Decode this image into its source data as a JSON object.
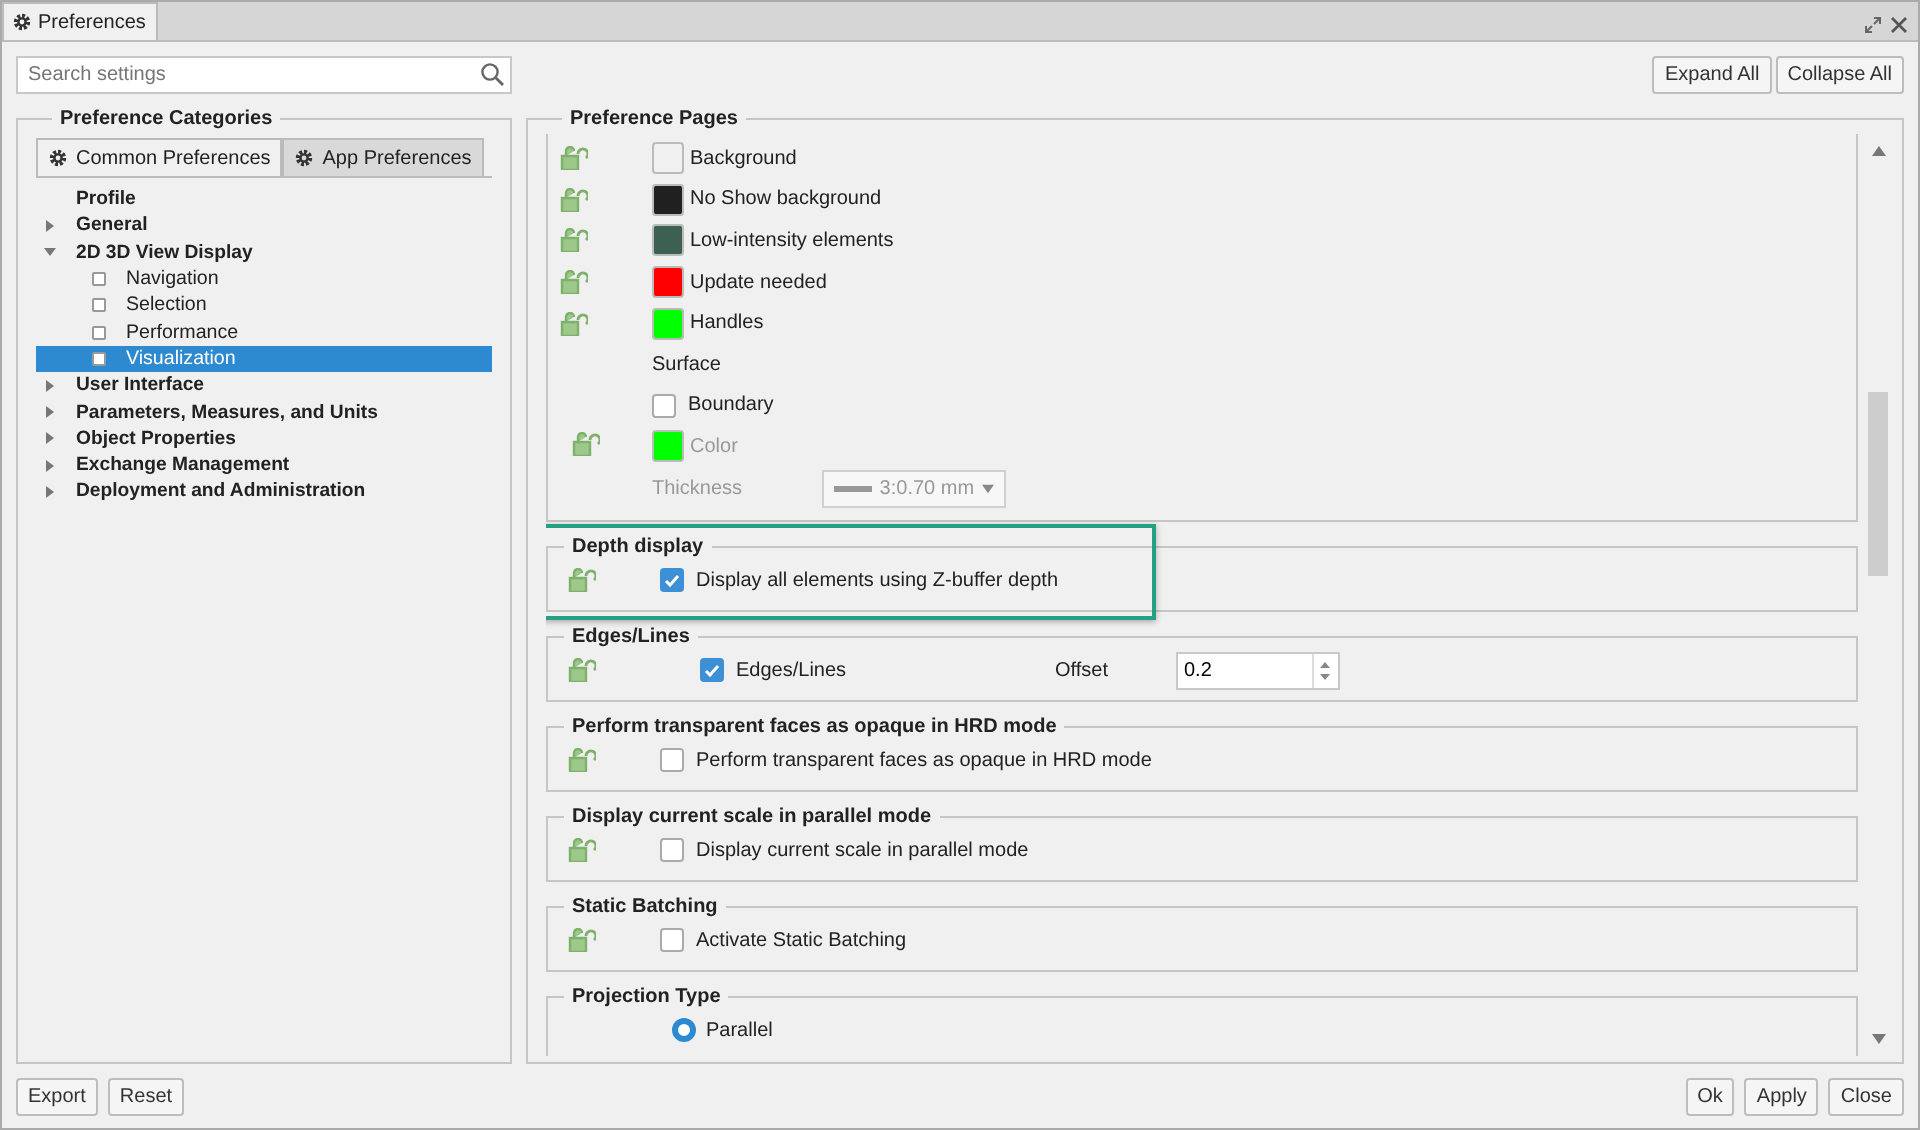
{
  "window": {
    "tab": "Preferences"
  },
  "search": {
    "placeholder": "Search settings"
  },
  "top_buttons": [
    "Expand All",
    "Collapse All"
  ],
  "categories": {
    "title": "Preference Categories",
    "tabs": [
      {
        "label": "Common Preferences",
        "selected": true
      },
      {
        "label": "App Preferences",
        "selected": false
      }
    ],
    "tree": [
      {
        "label": "Profile",
        "selected": false
      },
      {
        "label": "General",
        "expanded": false,
        "selected": false
      },
      {
        "label": "2D 3D View Display",
        "expanded": true,
        "selected": false,
        "children": [
          {
            "label": "Navigation",
            "selected": false
          },
          {
            "label": "Selection",
            "selected": false
          },
          {
            "label": "Performance",
            "selected": false
          },
          {
            "label": "Visualization",
            "selected": true
          }
        ]
      },
      {
        "label": "User Interface",
        "expanded": false,
        "selected": false
      },
      {
        "label": "Parameters, Measures, and Units",
        "expanded": false,
        "selected": false
      },
      {
        "label": "Object Properties",
        "expanded": false,
        "selected": false
      },
      {
        "label": "Exchange Management",
        "expanded": false,
        "selected": false
      },
      {
        "label": "Deployment and Administration",
        "expanded": false,
        "selected": false
      }
    ]
  },
  "pages": {
    "title": "Preference Pages",
    "color_rows": [
      {
        "label": "Background",
        "color": "#f0f0f0"
      },
      {
        "label": "No Show background",
        "color": "#202020"
      },
      {
        "label": "Low-intensity elements",
        "color": "#3d6150"
      },
      {
        "label": "Update needed",
        "color": "#ff0000"
      },
      {
        "label": "Handles",
        "color": "#00ff00"
      }
    ],
    "surface": {
      "heading": "Surface",
      "boundary": {
        "label": "Boundary",
        "checked": false
      },
      "color": {
        "label": "Color",
        "color": "#00ff00",
        "disabled": true
      },
      "thickness": {
        "label": "Thickness",
        "value": "3:0.70 mm",
        "disabled": true
      }
    },
    "groups": [
      {
        "title": "Depth display",
        "kind": "checkbox",
        "label": "Display all elements using Z-buffer depth",
        "checked": true,
        "highlighted": true
      },
      {
        "title": "Edges/Lines",
        "kind": "offset",
        "label": "Edges/Lines",
        "checked": true,
        "offset_label": "Offset",
        "offset_value": "0.2",
        "highlighted": false
      },
      {
        "title": "Perform transparent faces as opaque in HRD mode",
        "kind": "checkbox",
        "label": "Perform transparent faces as opaque in HRD mode",
        "checked": false,
        "highlighted": false
      },
      {
        "title": "Display current scale in parallel mode",
        "kind": "checkbox",
        "label": "Display current scale in parallel mode",
        "checked": false,
        "highlighted": false
      },
      {
        "title": "Static Batching",
        "kind": "checkbox",
        "label": "Activate Static Batching",
        "checked": false,
        "highlighted": false
      },
      {
        "title": "Projection Type",
        "kind": "radio",
        "label": "Parallel",
        "checked": true,
        "highlighted": false
      }
    ]
  },
  "left_buttons": [
    "Export",
    "Reset"
  ],
  "right_buttons": [
    "Ok",
    "Apply",
    "Close"
  ]
}
